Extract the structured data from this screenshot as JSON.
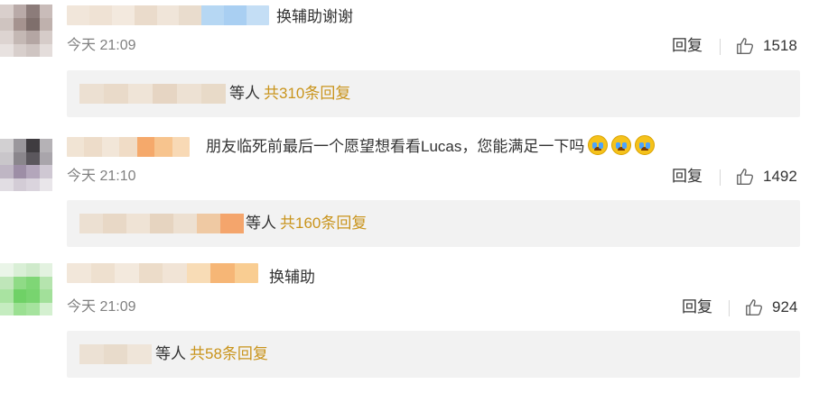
{
  "comments": [
    {
      "text": "换辅助谢谢",
      "time": "今天 21:09",
      "reply_label": "回复",
      "likes": "1518",
      "replies": {
        "prefix": "等人",
        "link": "共310条回复"
      }
    },
    {
      "text": "朋友临死前最后一个愿望想看看Lucas，您能满足一下吗",
      "emoji": "crying-face",
      "time": "今天 21:10",
      "reply_label": "回复",
      "likes": "1492",
      "replies": {
        "prefix": "等人",
        "link": "共160条回复"
      }
    },
    {
      "text": "换辅助",
      "time": "今天 21:09",
      "reply_label": "回复",
      "likes": "924",
      "replies": {
        "prefix": "等人",
        "link": "共58条回复"
      }
    }
  ],
  "colors": {
    "accent": "#c9941c",
    "meta_gray": "#808080",
    "reply_bg": "#f2f2f2"
  }
}
